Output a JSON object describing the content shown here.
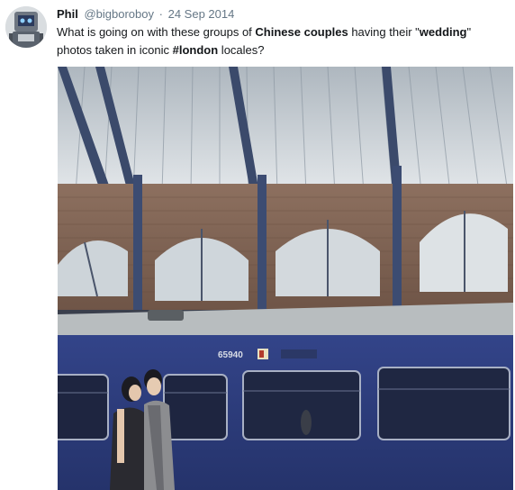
{
  "tweet": {
    "name": "Phil",
    "handle": "@bigboroboy",
    "separator": "·",
    "date": "24 Sep 2014",
    "text": {
      "p1": "What is going on with these groups of ",
      "b1": "Chinese couples",
      "p2": " having their \"",
      "b2": "wedding",
      "p3": "\" photos taken in iconic ",
      "hashtag": "#london",
      "p4": " locales?"
    },
    "media": {
      "train_number": "65940",
      "description_icon": "photo"
    }
  },
  "colors": {
    "train_blue": "#2f3f86",
    "brick": "#8a6a58",
    "roof": "#cfd6da",
    "text_dark": "#14171a",
    "text_muted": "#657786"
  }
}
